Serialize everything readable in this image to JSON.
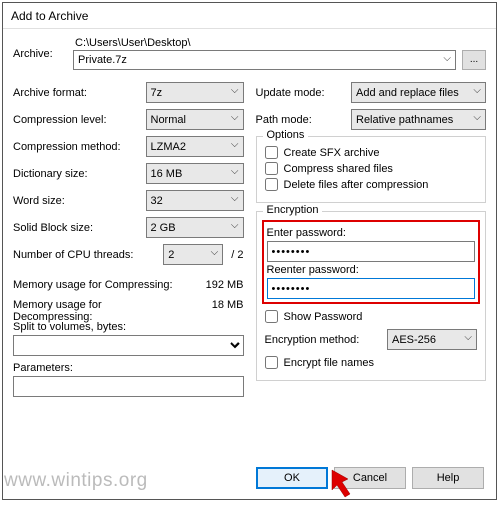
{
  "window": {
    "title": "Add to Archive"
  },
  "archive": {
    "label": "Archive:",
    "path": "C:\\Users\\User\\Desktop\\",
    "filename": "Private.7z",
    "browse": "..."
  },
  "left": {
    "format_label": "Archive format:",
    "format_value": "7z",
    "level_label": "Compression level:",
    "level_value": "Normal",
    "method_label": "Compression method:",
    "method_value": "LZMA2",
    "dict_label": "Dictionary size:",
    "dict_value": "16 MB",
    "word_label": "Word size:",
    "word_value": "32",
    "block_label": "Solid Block size:",
    "block_value": "2 GB",
    "cpu_label": "Number of CPU threads:",
    "cpu_value": "2",
    "cpu_total": "/ 2",
    "mem_comp_label": "Memory usage for Compressing:",
    "mem_comp_value": "192 MB",
    "mem_decomp_label": "Memory usage for Decompressing:",
    "mem_decomp_value": "18 MB",
    "split_label": "Split to volumes, bytes:",
    "param_label": "Parameters:"
  },
  "right": {
    "update_label": "Update mode:",
    "update_value": "Add and replace files",
    "path_label": "Path mode:",
    "path_value": "Relative pathnames",
    "options_title": "Options",
    "opt_sfx": "Create SFX archive",
    "opt_shared": "Compress shared files",
    "opt_delete": "Delete files after compression",
    "enc_title": "Encryption",
    "enter_pw": "Enter password:",
    "reenter_pw": "Reenter password:",
    "pw_value": "••••••••",
    "pw_value2": "••••••••",
    "show_pw": "Show Password",
    "enc_method_label": "Encryption method:",
    "enc_method_value": "AES-256",
    "encrypt_names": "Encrypt file names"
  },
  "buttons": {
    "ok": "OK",
    "cancel": "Cancel",
    "help": "Help"
  },
  "watermark": "www.wintips.org"
}
